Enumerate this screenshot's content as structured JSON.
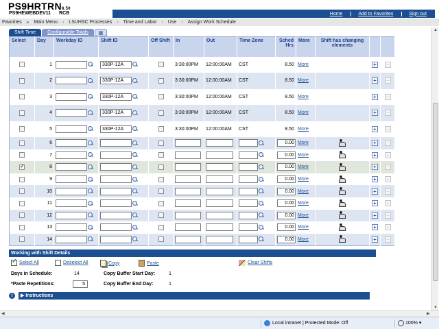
{
  "header": {
    "title": "PS9HRTRN",
    "version": "8.50",
    "db": "PS9HEWEBDEV11",
    "user": "RCB",
    "links": [
      "Home",
      "Add to Favorites",
      "Sign out"
    ]
  },
  "breadcrumb": [
    "Favorites",
    "Main Menu",
    "LSUHSC Processes",
    "Time and Labor",
    "Use",
    "Assign Work Schedule"
  ],
  "tabs": [
    "Shift Time",
    "Configurable Totals"
  ],
  "columns": [
    "Select",
    "Day",
    "Workday ID",
    "Shift ID",
    "Off Shift",
    "In",
    "Out",
    "Time Zone",
    "Sched Hrs",
    "More",
    "Shift has changing elements"
  ],
  "rows": [
    {
      "day": "1",
      "shift_id": "330P-12A",
      "in": "3:30:00PM",
      "out": "12:00:00AM",
      "tz": "CST",
      "hrs": "8.50",
      "more": "More",
      "checked": false
    },
    {
      "day": "2",
      "shift_id": "330P-12A",
      "in": "3:30:00PM",
      "out": "12:00:00AM",
      "tz": "CST",
      "hrs": "8.50",
      "more": "More",
      "checked": false
    },
    {
      "day": "3",
      "shift_id": "330P-12A",
      "in": "3:30:00PM",
      "out": "12:00:00AM",
      "tz": "CST",
      "hrs": "8.50",
      "more": "More",
      "checked": false
    },
    {
      "day": "4",
      "shift_id": "330P-12A",
      "in": "3:30:00PM",
      "out": "12:00:00AM",
      "tz": "CST",
      "hrs": "8.50",
      "more": "More",
      "checked": false
    },
    {
      "day": "5",
      "shift_id": "330P-12A",
      "in": "3:30:00PM",
      "out": "12:00:00AM",
      "tz": "CST",
      "hrs": "8.50",
      "more": "More",
      "checked": false
    },
    {
      "day": "6",
      "shift_id": "",
      "in": "",
      "out": "",
      "tz": "",
      "hrs": "0.00",
      "more": "More",
      "checked": false
    },
    {
      "day": "7",
      "shift_id": "",
      "in": "",
      "out": "",
      "tz": "",
      "hrs": "0.00",
      "more": "More",
      "checked": false
    },
    {
      "day": "8",
      "shift_id": "",
      "in": "",
      "out": "",
      "tz": "",
      "hrs": "0.00",
      "more": "More",
      "checked": true
    },
    {
      "day": "9",
      "shift_id": "",
      "in": "",
      "out": "",
      "tz": "",
      "hrs": "0.00",
      "more": "More",
      "checked": false
    },
    {
      "day": "10",
      "shift_id": "",
      "in": "",
      "out": "",
      "tz": "",
      "hrs": "0.00",
      "more": "More",
      "checked": false
    },
    {
      "day": "11",
      "shift_id": "",
      "in": "",
      "out": "",
      "tz": "",
      "hrs": "0.00",
      "more": "More",
      "checked": false
    },
    {
      "day": "12",
      "shift_id": "",
      "in": "",
      "out": "",
      "tz": "",
      "hrs": "0.00",
      "more": "More",
      "checked": false
    },
    {
      "day": "13",
      "shift_id": "",
      "in": "",
      "out": "",
      "tz": "",
      "hrs": "0.00",
      "more": "More",
      "checked": false
    },
    {
      "day": "14",
      "shift_id": "",
      "in": "",
      "out": "",
      "tz": "",
      "hrs": "0.00",
      "more": "More",
      "checked": false
    }
  ],
  "details": {
    "title": "Working with Shift Details",
    "actions": [
      "Select All",
      "Deselect All",
      "Copy",
      "Paste",
      "Clear Shifts"
    ],
    "days_label": "Days in Schedule:",
    "days_value": "14",
    "paste_label": "*Paste Repetitions:",
    "paste_value": "5",
    "buf_start_label": "Copy Buffer Start Day:",
    "buf_start_value": "1",
    "buf_end_label": "Copy Buffer End Day:",
    "buf_end_value": "1",
    "instructions": "Instructions"
  },
  "status": {
    "zone": "Local intranet | Protected Mode: Off",
    "zoom": "100%"
  }
}
